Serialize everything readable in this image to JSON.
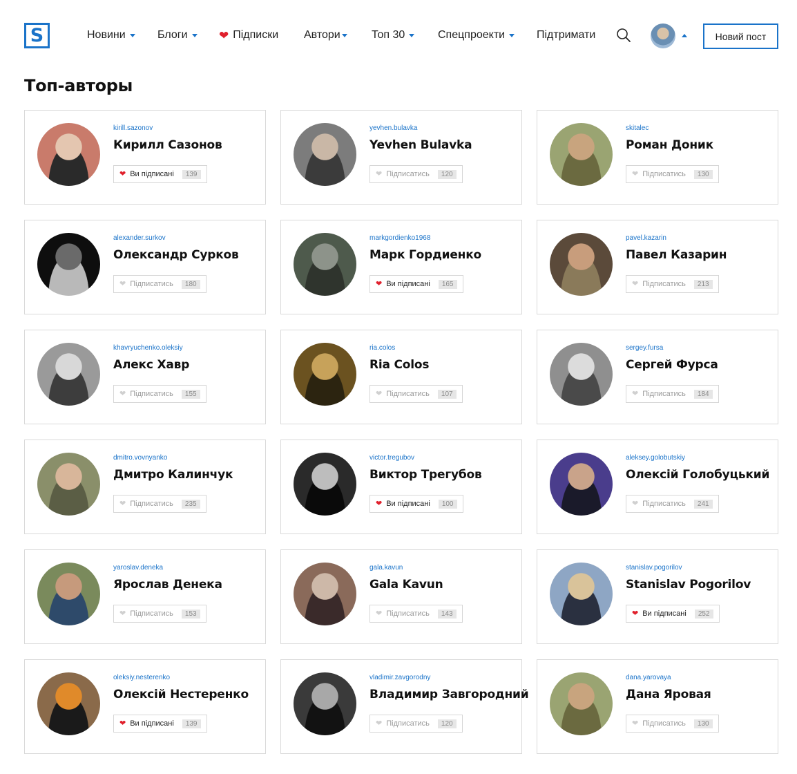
{
  "header": {
    "logo_letter": "S",
    "nav": [
      {
        "label": "Новини",
        "has_caret": true
      },
      {
        "label": "Блоги",
        "has_caret": true
      },
      {
        "label": "Підписки",
        "has_caret": false,
        "heart": true
      },
      {
        "label": "Автори",
        "has_caret": true
      },
      {
        "label": "Топ 30",
        "has_caret": true
      },
      {
        "label": "Спецпроекти",
        "has_caret": true
      },
      {
        "label": "Підтримати",
        "has_caret": false
      }
    ],
    "new_post_label": "Новий пост"
  },
  "page_title": "Топ-авторы",
  "subscribed_label": "Ви підписані",
  "subscribe_label": "Підписатись",
  "colors": {
    "accent": "#1a73c9",
    "heart": "#e0202c",
    "border": "#d9d9d9"
  },
  "authors": [
    {
      "username": "kirill.sazonov",
      "name": "Кирилл Сазонов",
      "subscribed": true,
      "count": "139",
      "avatar": [
        "#c97b6b",
        "#e4c6b0",
        "#2a2a2a"
      ]
    },
    {
      "username": "yevhen.bulavka",
      "name": "Yevhen Bulavka",
      "subscribed": false,
      "count": "120",
      "avatar": [
        "#7c7c7c",
        "#c9b7a6",
        "#3b3b3b"
      ]
    },
    {
      "username": "skitalec",
      "name": "Роман Доник",
      "subscribed": false,
      "count": "130",
      "avatar": [
        "#9aa472",
        "#c8a47e",
        "#6b6a40"
      ]
    },
    {
      "username": "alexander.surkov",
      "name": "Олександр Сурков",
      "subscribed": false,
      "count": "180",
      "avatar": [
        "#0e0e0e",
        "#6a6a6a",
        "#b9b9b9"
      ]
    },
    {
      "username": "markgordienko1968",
      "name": "Марк Гордиенко",
      "subscribed": true,
      "count": "165",
      "avatar": [
        "#4e5a4c",
        "#8d938a",
        "#2f342d"
      ]
    },
    {
      "username": "pavel.kazarin",
      "name": "Павел Казарин",
      "subscribed": false,
      "count": "213",
      "avatar": [
        "#5b4a3a",
        "#c89d7c",
        "#8a7a5a"
      ]
    },
    {
      "username": "khavryuchenko.oleksiy",
      "name": "Алекс Хавр",
      "subscribed": false,
      "count": "155",
      "avatar": [
        "#9a9a9a",
        "#d8d8d8",
        "#3d3d3d"
      ]
    },
    {
      "username": "ria.colos",
      "name": "Ria Colos",
      "subscribed": false,
      "count": "107",
      "avatar": [
        "#6b5220",
        "#c7a25a",
        "#2c2410"
      ]
    },
    {
      "username": "sergey.fursa",
      "name": "Сергей Фурса",
      "subscribed": false,
      "count": "184",
      "avatar": [
        "#8f8f8f",
        "#dcdcdc",
        "#4a4a4a"
      ]
    },
    {
      "username": "dmitro.vovnyanko",
      "name": "Дмитро Калинчук",
      "subscribed": false,
      "count": "235",
      "avatar": [
        "#8a8f6a",
        "#d8b69a",
        "#5b5e45"
      ]
    },
    {
      "username": "victor.tregubov",
      "name": "Виктор Трегубов",
      "subscribed": true,
      "count": "100",
      "avatar": [
        "#2a2a2a",
        "#bdbdbd",
        "#0a0a0a"
      ]
    },
    {
      "username": "aleksey.golobutskiy",
      "name": "Олексій Голобуцький",
      "subscribed": false,
      "count": "241",
      "avatar": [
        "#4a3d8c",
        "#c9a38a",
        "#1a1a2a"
      ]
    },
    {
      "username": "yaroslav.deneka",
      "name": "Ярослав Денека",
      "subscribed": false,
      "count": "153",
      "avatar": [
        "#7a8a5c",
        "#c69a7c",
        "#2e4a6a"
      ]
    },
    {
      "username": "gala.kavun",
      "name": "Gala Kavun",
      "subscribed": false,
      "count": "143",
      "avatar": [
        "#8a6a5a",
        "#cdb8a8",
        "#3a2a2a"
      ]
    },
    {
      "username": "stanislav.pogorilov",
      "name": "Stanislav Pogorilov",
      "subscribed": true,
      "count": "252",
      "avatar": [
        "#8ea6c4",
        "#d9c39a",
        "#2a3040"
      ]
    },
    {
      "username": "oleksiy.nesterenko",
      "name": "Олексій Нестеренко",
      "subscribed": true,
      "count": "139",
      "avatar": [
        "#8a6a4a",
        "#e08a2a",
        "#1a1a1a"
      ]
    },
    {
      "username": "vladimir.zavgorodny",
      "name": "Владимир Завгородний",
      "subscribed": false,
      "count": "120",
      "avatar": [
        "#3a3a3a",
        "#a8a8a8",
        "#121212"
      ]
    },
    {
      "username": "dana.yarovaya",
      "name": "Дана Яровая",
      "subscribed": false,
      "count": "130",
      "avatar": [
        "#9aa472",
        "#c8a47e",
        "#6b6a40"
      ]
    }
  ]
}
